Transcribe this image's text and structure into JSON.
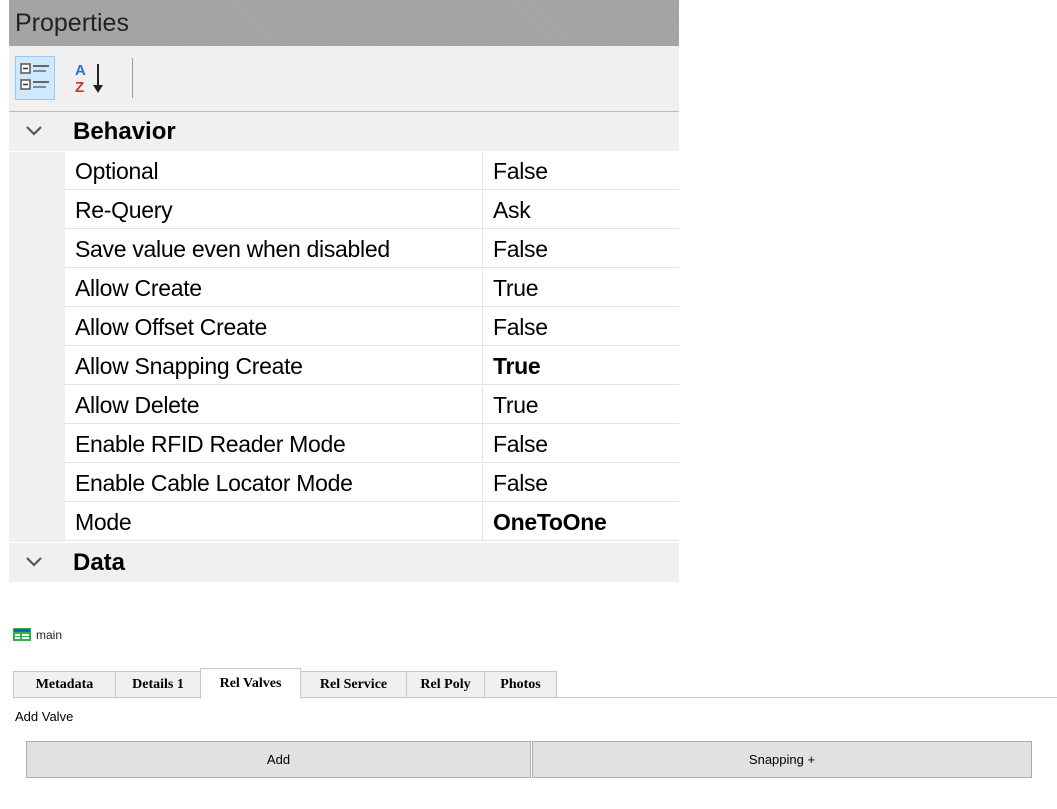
{
  "properties": {
    "title": "Properties",
    "toolbar": {
      "categorized_icon": "categorized-icon",
      "alphabetical_icon": "sort-alphabetical-icon"
    },
    "categories": [
      {
        "name": "Behavior",
        "expanded": true,
        "rows": [
          {
            "name": "Optional",
            "value": "False",
            "bold": false
          },
          {
            "name": "Re-Query",
            "value": "Ask",
            "bold": false
          },
          {
            "name": "Save value even when disabled",
            "value": "False",
            "bold": false
          },
          {
            "name": "Allow Create",
            "value": "True",
            "bold": false
          },
          {
            "name": "Allow Offset Create",
            "value": "False",
            "bold": false
          },
          {
            "name": "Allow Snapping Create",
            "value": "True",
            "bold": true
          },
          {
            "name": "Allow Delete",
            "value": "True",
            "bold": false
          },
          {
            "name": "Enable RFID Reader Mode",
            "value": "False",
            "bold": false
          },
          {
            "name": "Enable Cable Locator Mode",
            "value": "False",
            "bold": false
          },
          {
            "name": "Mode",
            "value": "OneToOne",
            "bold": true
          }
        ]
      },
      {
        "name": "Data",
        "expanded": true,
        "rows": []
      }
    ]
  },
  "form": {
    "title": "main",
    "icon": "form-icon",
    "tabs": [
      {
        "label": "Metadata",
        "active": false
      },
      {
        "label": "Details 1",
        "active": false
      },
      {
        "label": "Rel Valves",
        "active": true
      },
      {
        "label": "Rel Service",
        "active": false
      },
      {
        "label": "Rel Poly",
        "active": false
      },
      {
        "label": "Photos",
        "active": false
      }
    ],
    "section_label": "Add Valve",
    "buttons": {
      "add": "Add",
      "snapping": "Snapping +"
    }
  },
  "colors": {
    "title_bar": "#a7a7a7",
    "toolbar": "#f0f0f0",
    "selected_button": "#cde8ff",
    "button_face": "#e1e1e1"
  }
}
